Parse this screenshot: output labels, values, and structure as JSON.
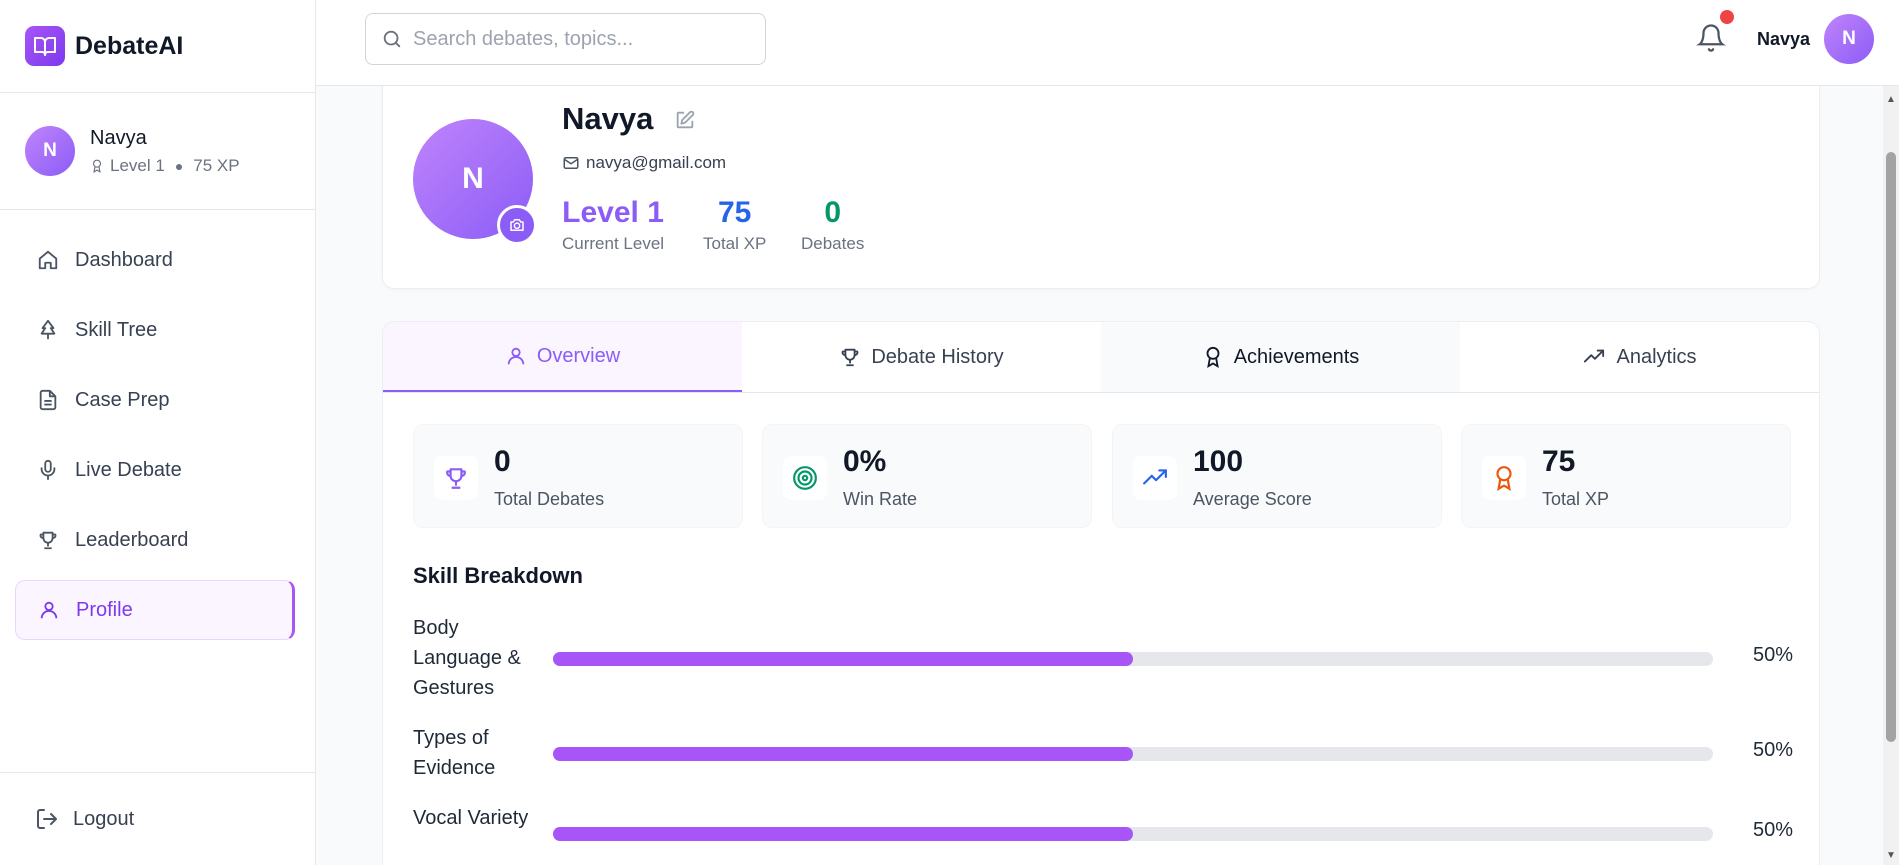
{
  "brand": {
    "name": "DebateAI"
  },
  "sidebar_user": {
    "initial": "N",
    "name": "Navya",
    "level": "Level 1",
    "xp": "75 XP"
  },
  "nav": {
    "items": [
      {
        "label": "Dashboard",
        "icon": "home-icon"
      },
      {
        "label": "Skill Tree",
        "icon": "tree-icon"
      },
      {
        "label": "Case Prep",
        "icon": "file-text-icon"
      },
      {
        "label": "Live Debate",
        "icon": "mic-icon"
      },
      {
        "label": "Leaderboard",
        "icon": "trophy-icon"
      },
      {
        "label": "Profile",
        "icon": "user-icon",
        "active": true
      }
    ],
    "logout": "Logout"
  },
  "header": {
    "search_placeholder": "Search debates, topics...",
    "user_name": "Navya",
    "user_initial": "N"
  },
  "profile": {
    "initial": "N",
    "name": "Navya",
    "email": "navya@gmail.com",
    "stats": [
      {
        "value": "Level 1",
        "label": "Current Level",
        "color": "#8b5cf6"
      },
      {
        "value": "75",
        "label": "Total XP",
        "color": "#2563eb"
      },
      {
        "value": "0",
        "label": "Debates",
        "color": "#059669"
      }
    ]
  },
  "tabs": [
    {
      "label": "Overview",
      "icon": "user-icon",
      "active": true
    },
    {
      "label": "Debate History",
      "icon": "trophy-icon"
    },
    {
      "label": "Achievements",
      "icon": "award-icon"
    },
    {
      "label": "Analytics",
      "icon": "trending-up-icon"
    }
  ],
  "overview": {
    "cards": [
      {
        "value": "0",
        "label": "Total Debates",
        "icon": "trophy-icon",
        "color": "#8b5cf6"
      },
      {
        "value": "0%",
        "label": "Win Rate",
        "icon": "target-icon",
        "color": "#059669"
      },
      {
        "value": "100",
        "label": "Average Score",
        "icon": "trending-up-icon",
        "color": "#2563eb"
      },
      {
        "value": "75",
        "label": "Total XP",
        "icon": "award-icon",
        "color": "#ea580c"
      }
    ],
    "skill_title": "Skill Breakdown",
    "skills": [
      {
        "name": "Body Language & Gestures",
        "progress": 0.5,
        "pct": "50%"
      },
      {
        "name": "Types of Evidence",
        "progress": 0.5,
        "pct": "50%"
      },
      {
        "name": "Vocal Variety",
        "progress": 0.5,
        "pct": "50%"
      }
    ]
  }
}
